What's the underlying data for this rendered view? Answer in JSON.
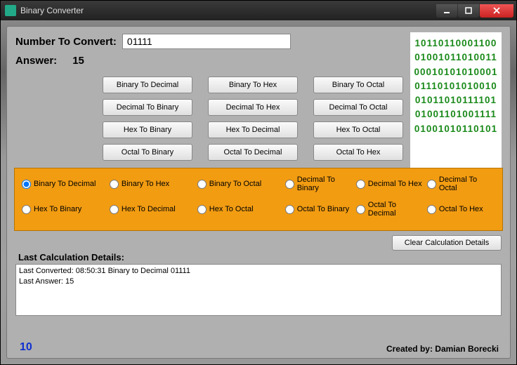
{
  "window": {
    "title": "Binary Converter"
  },
  "input": {
    "label": "Number To Convert:",
    "value": "01111"
  },
  "answer": {
    "label": "Answer:",
    "value": "15"
  },
  "buttons": [
    "Binary To Decimal",
    "Binary To Hex",
    "Binary To Octal",
    "Decimal To Binary",
    "Decimal To Hex",
    "Decimal To Octal",
    "Hex To Binary",
    "Hex To Decimal",
    "Hex To Octal",
    "Octal To Binary",
    "Octal To Decimal",
    "Octal To Hex"
  ],
  "matrix": [
    "10110110001100",
    "01001011010011",
    "00010101010001",
    "01110101010010",
    "01011010111101",
    "01001101001111",
    "01001010110101"
  ],
  "radios": {
    "row1a": [
      "Binary To Decimal",
      "Binary To Hex",
      "Binary To Octal"
    ],
    "row1b": [
      "Decimal To Binary",
      "Decimal To Hex",
      "Decimal To Octal"
    ],
    "row2a": [
      "Hex To Binary",
      "Hex To Decimal",
      "Hex To Octal"
    ],
    "row2b": [
      "Octal To Binary",
      "Octal To Decimal",
      "Octal To Hex"
    ],
    "selected": "Binary To Decimal"
  },
  "clear_button": "Clear Calculation Details",
  "details": {
    "header": "Last Calculation Details:",
    "body": "Last Converted: 08:50:31  Binary to Decimal 01111\nLast Answer: 15"
  },
  "footer": {
    "version": "10",
    "credit": "Created by: Damian Borecki"
  }
}
